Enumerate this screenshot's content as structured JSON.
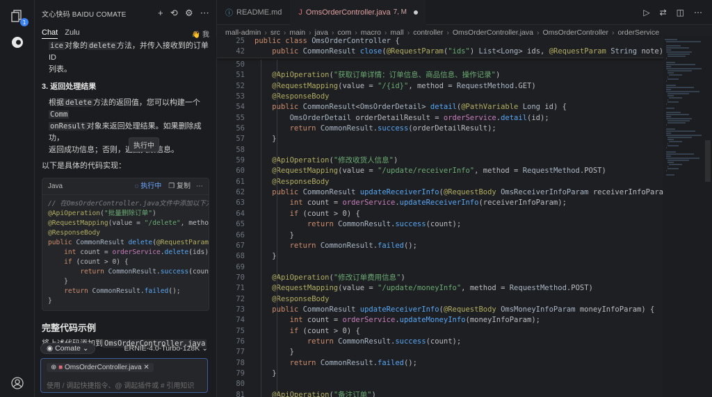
{
  "activity_bar": {
    "explorer_badge": "1"
  },
  "chat_panel": {
    "title": "文心快码 BAIDU COMATE",
    "tabs": [
      "Chat",
      "Zulu"
    ],
    "user_label": "我",
    "body": {
      "intro_line1_tail": "ice对象的delete方法，并传入接收到的订单ID",
      "intro_line1_code_a": "ice",
      "intro_line1_text_a": "对象的",
      "intro_line1_code_b": "delete",
      "intro_line1_text_b": "方法，并传入接收到的订单ID",
      "intro_line2": "列表。",
      "step3_title": "3. 返回处理结果",
      "step3_l1_a": "根据",
      "step3_l1_code": "delete",
      "step3_l1_b": "方法的返回值，您可以构建一个",
      "step3_l1_code2": "Comm",
      "step3_l2_code": "onResult",
      "step3_l2_b": "对象来返回处理结果。如果删除成功，",
      "step3_l3": "返回成功信息；否则，返回失败信息。",
      "impl_text": "以下是具体的代码实现："
    },
    "code_card": {
      "language": "Java",
      "running_label": "执行中",
      "copy_label": "复制",
      "tooltip": "执行中",
      "lines": [
        "// 在OmsOrderController.java文件中添加以下方法",
        "@ApiOperation(\"批量删除订单\")",
        "@RequestMapping(value = \"/delete\", method",
        "@ResponseBody",
        "public CommonResult delete(@RequestParam(\"",
        "    int count = orderService.delete(ids);",
        "    if (count > 0) {",
        "        return CommonResult.success(count)",
        "    }",
        "    return CommonResult.failed();",
        "}"
      ]
    },
    "full_example_title": "完整代码示例",
    "full_example_text_a": "将上述代码添加到",
    "full_example_file": "OmsOrderController.java",
    "agent_selector": "Comate",
    "model_name": "ERNIE-4.0-Turbo-128K",
    "attached_file": "OmsOrderController.java",
    "input_placeholder": "使用 / 调起快捷指令、@ 调起插件或 # 引用知识"
  },
  "editor": {
    "tabs": [
      {
        "label": "README.md",
        "status": ""
      },
      {
        "label": "OmsOrderController.java",
        "status": "7, M"
      }
    ],
    "breadcrumb": [
      "mall-admin",
      "src",
      "main",
      "java",
      "com",
      "macro",
      "mall",
      "controller",
      "OmsOrderController.java",
      "OmsOrderController",
      "orderService"
    ],
    "sticky_lines": [
      {
        "n": "25",
        "t": "public class OmsOrderController {"
      },
      {
        "n": "42",
        "t": "    public CommonResult close(@RequestParam(\"ids\") List<Long> ids, @RequestParam String note) {"
      }
    ],
    "lines": [
      {
        "n": "50",
        "t": ""
      },
      {
        "n": "51",
        "t": "    @ApiOperation(\"获取订单详情：订单信息、商品信息、操作记录\")"
      },
      {
        "n": "52",
        "t": "    @RequestMapping(value = \"/{id}\", method = RequestMethod.GET)"
      },
      {
        "n": "53",
        "t": "    @ResponseBody"
      },
      {
        "n": "54",
        "t": "    public CommonResult<OmsOrderDetail> detail(@PathVariable Long id) {"
      },
      {
        "n": "55",
        "t": "        OmsOrderDetail orderDetailResult = orderService.detail(id);"
      },
      {
        "n": "56",
        "t": "        return CommonResult.success(orderDetailResult);"
      },
      {
        "n": "57",
        "t": "    }"
      },
      {
        "n": "58",
        "t": ""
      },
      {
        "n": "59",
        "t": "    @ApiOperation(\"修改收货人信息\")"
      },
      {
        "n": "60",
        "t": "    @RequestMapping(value = \"/update/receiverInfo\", method = RequestMethod.POST)"
      },
      {
        "n": "61",
        "t": "    @ResponseBody"
      },
      {
        "n": "62",
        "t": "    public CommonResult updateReceiverInfo(@RequestBody OmsReceiverInfoParam receiverInfoParam) {"
      },
      {
        "n": "63",
        "t": "        int count = orderService.updateReceiverInfo(receiverInfoParam);"
      },
      {
        "n": "64",
        "t": "        if (count > 0) {"
      },
      {
        "n": "65",
        "t": "            return CommonResult.success(count);"
      },
      {
        "n": "66",
        "t": "        }"
      },
      {
        "n": "67",
        "t": "        return CommonResult.failed();"
      },
      {
        "n": "68",
        "t": "    }"
      },
      {
        "n": "69",
        "t": ""
      },
      {
        "n": "70",
        "t": "    @ApiOperation(\"修改订单费用信息\")"
      },
      {
        "n": "71",
        "t": "    @RequestMapping(value = \"/update/moneyInfo\", method = RequestMethod.POST)"
      },
      {
        "n": "72",
        "t": "    @ResponseBody"
      },
      {
        "n": "73",
        "t": "    public CommonResult updateReceiverInfo(@RequestBody OmsMoneyInfoParam moneyInfoParam) {"
      },
      {
        "n": "74",
        "t": "        int count = orderService.updateMoneyInfo(moneyInfoParam);"
      },
      {
        "n": "75",
        "t": "        if (count > 0) {"
      },
      {
        "n": "76",
        "t": "            return CommonResult.success(count);"
      },
      {
        "n": "77",
        "t": "        }"
      },
      {
        "n": "78",
        "t": "        return CommonResult.failed();"
      },
      {
        "n": "79",
        "t": "    }"
      },
      {
        "n": "80",
        "t": ""
      },
      {
        "n": "81",
        "t": "    @ApiOperation(\"备注订单\")"
      }
    ]
  },
  "colors": {
    "keyword": "#cf8e6d",
    "annotation": "#b3ae60",
    "string": "#6aab73",
    "function": "#56a8f5",
    "variable": "#c77dbb",
    "accent": "#3b82f6"
  }
}
